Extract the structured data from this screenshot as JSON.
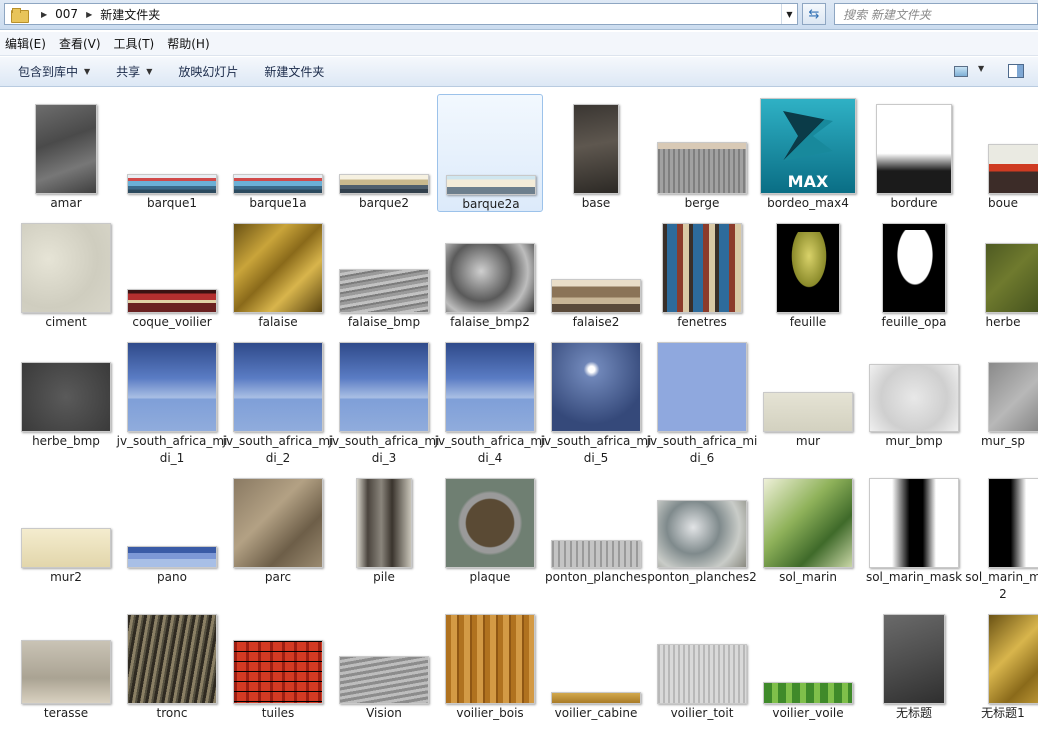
{
  "address_bar": {
    "crumbs": [
      "007",
      "新建文件夹"
    ],
    "search_placeholder": "搜索 新建文件夹"
  },
  "menu": [
    "编辑(E)",
    "查看(V)",
    "工具(T)",
    "帮助(H)"
  ],
  "command_bar": {
    "include_library": "包含到库中",
    "share": "共享",
    "slideshow": "放映幻灯片",
    "new_folder": "新建文件夹"
  },
  "files": [
    {
      "name": "amar",
      "texture": "t-gray"
    },
    {
      "name": "barque1",
      "texture": "t-boat"
    },
    {
      "name": "barque1a",
      "texture": "t-boat"
    },
    {
      "name": "barque2",
      "texture": "t-boat2"
    },
    {
      "name": "barque2a",
      "texture": "t-boat3",
      "selected": true
    },
    {
      "name": "base",
      "texture": "t-dark"
    },
    {
      "name": "berge",
      "texture": "t-berge-top"
    },
    {
      "name": "bordeo_max4",
      "texture": "t-max"
    },
    {
      "name": "bordure",
      "texture": "t-bordure"
    },
    {
      "name": "boue",
      "texture": "t-boue"
    },
    {
      "name": "ciment",
      "texture": "t-ciment"
    },
    {
      "name": "coque_voilier",
      "texture": "t-coque"
    },
    {
      "name": "falaise",
      "texture": "t-falaise"
    },
    {
      "name": "falaise_bmp",
      "texture": "t-falbmp"
    },
    {
      "name": "falaise_bmp2",
      "texture": "t-falbmp2"
    },
    {
      "name": "falaise2",
      "texture": "t-fal2"
    },
    {
      "name": "fenetres",
      "texture": "t-fenetres"
    },
    {
      "name": "feuille",
      "texture": "t-feuille"
    },
    {
      "name": "feuille_opa",
      "texture": "t-feuilleopa"
    },
    {
      "name": "herbe",
      "texture": "t-herbe"
    },
    {
      "name": "herbe_bmp",
      "texture": "t-herbebmp"
    },
    {
      "name": "jv_south_africa_midi_1",
      "texture": "t-sky"
    },
    {
      "name": "jv_south_africa_midi_2",
      "texture": "t-sky"
    },
    {
      "name": "jv_south_africa_midi_3",
      "texture": "t-sky"
    },
    {
      "name": "jv_south_africa_midi_4",
      "texture": "t-sky"
    },
    {
      "name": "jv_south_africa_midi_5",
      "texture": "t-sky5"
    },
    {
      "name": "jv_south_africa_midi_6",
      "texture": "t-sky6"
    },
    {
      "name": "mur",
      "texture": "t-mur"
    },
    {
      "name": "mur_bmp",
      "texture": "t-murbmp"
    },
    {
      "name": "mur_sp",
      "texture": "t-mursp"
    },
    {
      "name": "mur2",
      "texture": "t-mur2"
    },
    {
      "name": "pano",
      "texture": "t-pano"
    },
    {
      "name": "parc",
      "texture": "t-parc"
    },
    {
      "name": "pile",
      "texture": "t-pile"
    },
    {
      "name": "plaque",
      "texture": "t-plaque"
    },
    {
      "name": "ponton_planches",
      "texture": "t-ponton"
    },
    {
      "name": "ponton_planches2",
      "texture": "t-ponton2"
    },
    {
      "name": "sol_marin",
      "texture": "t-solmarin"
    },
    {
      "name": "sol_marin_mask",
      "texture": "t-solmask"
    },
    {
      "name": "sol_marin_m2",
      "texture": "t-solmarin2"
    },
    {
      "name": "terasse",
      "texture": "t-terasse"
    },
    {
      "name": "tronc",
      "texture": "t-tronc"
    },
    {
      "name": "tuiles",
      "texture": "t-tuiles"
    },
    {
      "name": "Vision",
      "texture": "t-vision"
    },
    {
      "name": "voilier_bois",
      "texture": "t-bois"
    },
    {
      "name": "voilier_cabine",
      "texture": "t-cabine"
    },
    {
      "name": "voilier_toit",
      "texture": "t-toit"
    },
    {
      "name": "voilier_voile",
      "texture": "t-voile"
    },
    {
      "name": "无标题",
      "texture": "t-sans"
    },
    {
      "name": "无标题1",
      "texture": "t-sans2"
    }
  ],
  "max_logo_text": "MAX"
}
